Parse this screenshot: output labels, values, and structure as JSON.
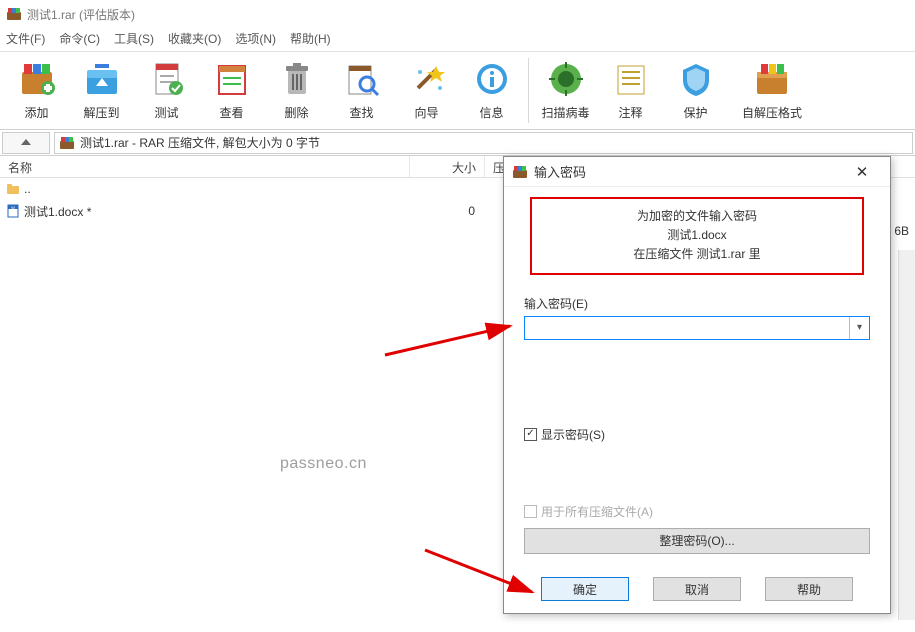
{
  "title": "测试1.rar (评估版本)",
  "menu": [
    "文件(F)",
    "命令(C)",
    "工具(S)",
    "收藏夹(O)",
    "选项(N)",
    "帮助(H)"
  ],
  "toolbar": [
    {
      "label": "添加"
    },
    {
      "label": "解压到"
    },
    {
      "label": "测试"
    },
    {
      "label": "查看"
    },
    {
      "label": "删除"
    },
    {
      "label": "查找"
    },
    {
      "label": "向导"
    },
    {
      "label": "信息"
    },
    {
      "label": "扫描病毒"
    },
    {
      "label": "注释"
    },
    {
      "label": "保护"
    },
    {
      "label": "自解压格式"
    }
  ],
  "pathbar": "测试1.rar - RAR 压缩文件, 解包大小为 0 字节",
  "columns": {
    "name": "名称",
    "size": "大小",
    "packed": "压缩"
  },
  "rows": [
    {
      "name": "..",
      "size": "",
      "type": "folder-up"
    },
    {
      "name": "测试1.docx *",
      "size": "0",
      "type": "docx"
    }
  ],
  "clip_text": "6B",
  "watermark": "passneo.cn",
  "dialog": {
    "title": "输入密码",
    "info_line1": "为加密的文件输入密码",
    "info_line2": "测试1.docx",
    "info_line3": "在压缩文件 测试1.rar 里",
    "field_label": "输入密码(E)",
    "password_value": "",
    "show_password": "显示密码(S)",
    "use_for_all": "用于所有压缩文件(A)",
    "manage": "整理密码(O)...",
    "ok": "确定",
    "cancel": "取消",
    "help": "帮助"
  }
}
